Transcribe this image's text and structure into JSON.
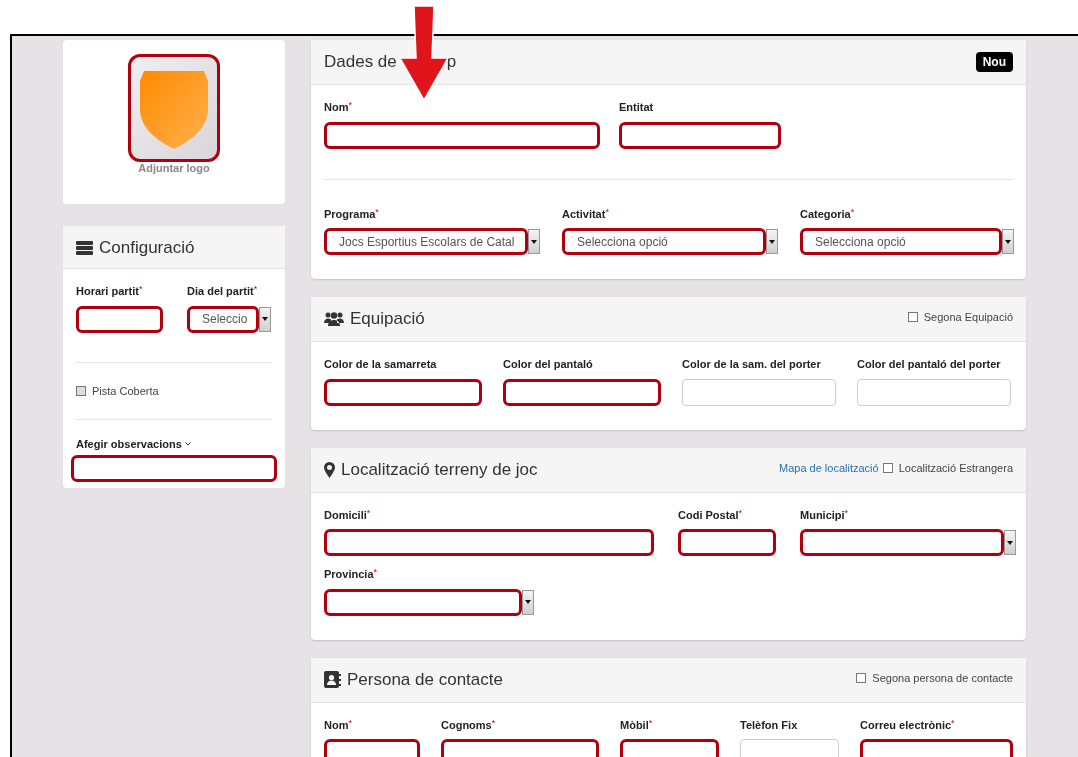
{
  "logo_card": {
    "caption": "Adjuntar logo",
    "flagged": true
  },
  "config": {
    "title": "Configuració",
    "fields": [
      {
        "label": "Horari partit",
        "mark": "*",
        "kind": "text",
        "flagged": true
      },
      {
        "label": "Dia del partit",
        "mark": "*",
        "kind": "select",
        "value": "Seleccio",
        "flagged": true
      }
    ],
    "checkbox": {
      "label": "Pista Coberta",
      "checked": false
    },
    "notes": {
      "label": "Afegir observacions",
      "flagged": true
    }
  },
  "sections": [
    {
      "title": "Dades de",
      "title_tail": "p",
      "badge": "Nou",
      "rows": [
        [
          {
            "label": "Nom",
            "mark": "*",
            "kind": "text",
            "flagged": true
          },
          {
            "label": "Entitat",
            "kind": "text",
            "flagged": true
          }
        ],
        [
          {
            "label": "Programa",
            "mark": "*",
            "kind": "select",
            "value": "Jocs Esportius Escolars de Catal",
            "flagged": true
          },
          {
            "label": "Activitat",
            "mark": "*",
            "kind": "select",
            "value": "Selecciona opció",
            "flagged": true
          },
          {
            "label": "Categoria",
            "mark": "*",
            "kind": "select",
            "value": "Selecciona opció",
            "flagged": true
          }
        ]
      ]
    },
    {
      "title": "Equipació",
      "checkbox": {
        "label": "Segona Equipació",
        "checked": false
      },
      "rows": [
        [
          {
            "label": "Color de la samarreta",
            "kind": "text",
            "flagged": true
          },
          {
            "label": "Color del pantaló",
            "kind": "text",
            "flagged": true
          },
          {
            "label": "Color de la sam. del porter",
            "kind": "text",
            "flagged": false
          },
          {
            "label": "Color del pantaló del porter",
            "kind": "text",
            "flagged": false
          }
        ]
      ]
    },
    {
      "title": "Localització terreny de joc",
      "link": "Mapa de localització",
      "checkbox": {
        "label": "Localització Estrangera",
        "checked": false
      },
      "rows": [
        [
          {
            "label": "Domicili",
            "mark": "*",
            "kind": "text",
            "flagged": true
          },
          {
            "label": "Codi Postal",
            "mark": "*",
            "kind": "text",
            "flagged": true
          },
          {
            "label": "Municipi",
            "mark": "*",
            "kind": "select",
            "flagged": true
          }
        ],
        [
          {
            "label": "Provincia",
            "mark": "*",
            "kind": "select",
            "flagged": true
          }
        ]
      ]
    },
    {
      "title": "Persona de contacte",
      "checkbox": {
        "label": "Segona persona de contacte",
        "checked": false
      },
      "rows": [
        [
          {
            "label": "Nom",
            "mark": "*",
            "kind": "text",
            "flagged": true
          },
          {
            "label": "Cognoms",
            "mark": "*",
            "kind": "text",
            "flagged": true
          },
          {
            "label": "Mòbil",
            "mark": "*",
            "kind": "text",
            "flagged": true
          },
          {
            "label": "Telèfon Fix",
            "kind": "text",
            "flagged": false
          },
          {
            "label": "Correu electrònic",
            "mark": "*",
            "kind": "text",
            "flagged": true
          }
        ]
      ]
    }
  ]
}
